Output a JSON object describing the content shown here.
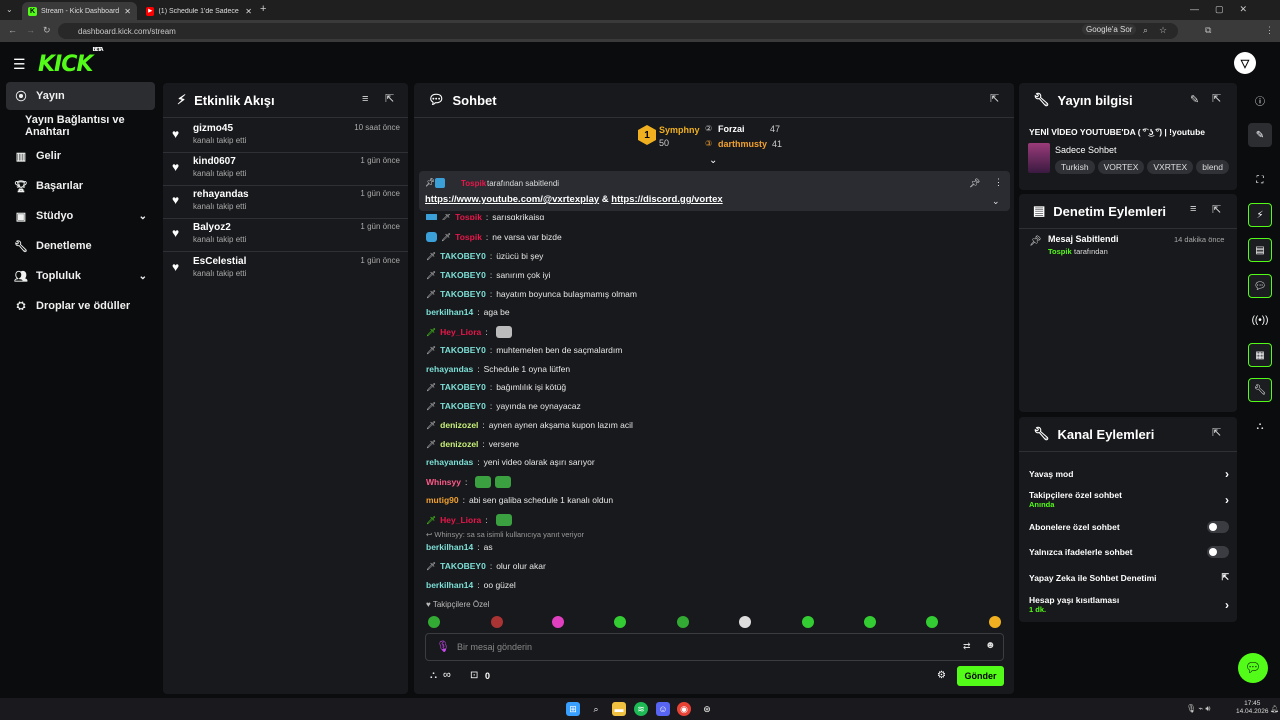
{
  "browser": {
    "tabs": [
      {
        "label": "Stream - Kick Dashboard",
        "icon": "kick-favicon-icon"
      },
      {
        "label": "(1) Schedule 1'de Sadece KUMA",
        "icon": "youtube-favicon-icon"
      }
    ],
    "url": "dashboard.kick.com/stream",
    "google_label": "Google'a Sor"
  },
  "logo": {
    "text": "KICK",
    "beta": "BETA"
  },
  "sidebar": {
    "items": [
      {
        "label": "Yayın",
        "icon": "broadcast-icon"
      },
      {
        "label": "Yayın Bağlantısı ve Anahtarı"
      },
      {
        "label": "Gelir",
        "icon": "chart-icon"
      },
      {
        "label": "Başarılar",
        "icon": "trophy-icon"
      },
      {
        "label": "Stüdyo",
        "icon": "studio-icon"
      },
      {
        "label": "Denetleme",
        "icon": "wrench-icon"
      },
      {
        "label": "Topluluk",
        "icon": "community-icon"
      },
      {
        "label": "Droplar ve ödüller",
        "icon": "drops-icon"
      }
    ]
  },
  "activity": {
    "title": "Etkinlik Akışı",
    "items": [
      {
        "name": "gizmo45",
        "action": "kanalı takip etti",
        "time": "10 saat önce"
      },
      {
        "name": "kind0607",
        "action": "kanalı takip etti",
        "time": "1 gün önce"
      },
      {
        "name": "rehayandas",
        "action": "kanalı takip etti",
        "time": "1 gün önce"
      },
      {
        "name": "Balyoz2",
        "action": "kanalı takip etti",
        "time": "1 gün önce"
      },
      {
        "name": "EsCelestial",
        "action": "kanalı takip etti",
        "time": "1 gün önce"
      }
    ]
  },
  "chat": {
    "title": "Sohbet",
    "leaderboard": [
      {
        "name": "Symphny",
        "value": "50"
      },
      {
        "name": "Forzai",
        "value": "47"
      },
      {
        "name": "darthmusty",
        "value": "41"
      }
    ],
    "pinned": {
      "by_user": "Tospik",
      "by_text": "tarafından sabitlendi",
      "link1": "https://www.youtube.com/@vxrtexplay",
      "amp": "&",
      "link2": "https://discord.gg/vortex"
    },
    "messages": [
      {
        "user": "Tospik",
        "text": "sarışgkrikaisg",
        "color": "#e8164a"
      },
      {
        "user": "Tospik",
        "text": "ne varsa var bizde",
        "color": "#e8164a"
      },
      {
        "user": "TAKOBEY0",
        "text": "üzücü bi şey",
        "color": "#7de0d8"
      },
      {
        "user": "TAKOBEY0",
        "text": "sanırım çok iyi",
        "color": "#7de0d8"
      },
      {
        "user": "TAKOBEY0",
        "text": "hayatım boyunca bulaşmamış olmam",
        "color": "#7de0d8"
      },
      {
        "user": "berkilhan14",
        "text": "aga be",
        "color": "#7de0d8"
      },
      {
        "user": "Hey_Liora",
        "text": "",
        "color": "#e8164a"
      },
      {
        "user": "TAKOBEY0",
        "text": "muhtemelen ben de saçmalardım",
        "color": "#7de0d8"
      },
      {
        "user": "rehayandas",
        "text": "Schedule 1 oyna lütfen",
        "color": "#7de0d8"
      },
      {
        "user": "TAKOBEY0",
        "text": "bağımlılık işi kötüğ",
        "color": "#7de0d8"
      },
      {
        "user": "TAKOBEY0",
        "text": "yayında ne oynayacaz",
        "color": "#7de0d8"
      },
      {
        "user": "denizozel",
        "text": "aynen aynen akşama kupon lazım acil",
        "color": "#c8f07a"
      },
      {
        "user": "denizozel",
        "text": "versene",
        "color": "#c8f07a"
      },
      {
        "user": "rehayandas",
        "text": "yeni video olarak aşırı sarıyor",
        "color": "#7de0d8"
      },
      {
        "user": "Whinsyy",
        "text": "",
        "color": "#ff5a8a"
      },
      {
        "user": "mutig90",
        "text": "abi sen galiba schedule 1 kanalı oldun",
        "color": "#f0a030"
      },
      {
        "user": "Hey_Liora",
        "text": "",
        "color": "#e8164a"
      },
      {
        "user": "berkilhan14",
        "text": "as",
        "color": "#7de0d8"
      },
      {
        "user": "TAKOBEY0",
        "text": "olur olur akar",
        "color": "#7de0d8"
      },
      {
        "user": "berkilhan14",
        "text": "oo güzel",
        "color": "#7de0d8"
      }
    ],
    "reply_note": "Whinsyy: sa sa isimli kullanıcıya yanıt veriyor",
    "followers_only": "Takipçilere Özel",
    "input_placeholder": "Bir mesaj gönderin",
    "infinity": "∞",
    "points": "0",
    "send_label": "Gönder"
  },
  "stream_info": {
    "title": "Yayın bilgisi",
    "stream_title": "YENİ VİDEO YOUTUBE'DA ( ͡° ͜ʖ ͡°) | !youtube",
    "category": "Sadece Sohbet",
    "tags": [
      "Turkish",
      "VORTEX",
      "VXRTEX",
      "blend"
    ]
  },
  "mod_actions": {
    "title": "Denetim Eylemleri",
    "item": {
      "action": "Mesaj Sabitlendi",
      "time": "14 dakika önce",
      "by_user": "Tospik",
      "by_text": "tarafından"
    }
  },
  "channel_actions": {
    "title": "Kanal Eylemleri",
    "rows": [
      {
        "label": "Yavaş mod",
        "sub": ""
      },
      {
        "label": "Takipçilere özel sohbet",
        "sub": "Anında"
      },
      {
        "label": "Abonelere özel sohbet",
        "sub": ""
      },
      {
        "label": "Yalnızca ifadelerle sohbet",
        "sub": ""
      },
      {
        "label": "Yapay Zeka ile Sohbet Denetimi",
        "sub": ""
      },
      {
        "label": "Hesap yaşı kısıtlaması",
        "sub": "1 dk."
      }
    ]
  },
  "taskbar": {
    "time": "17:45",
    "date": "14.04.2026"
  },
  "colors": {
    "accent": "#53fc18",
    "panel": "#18191c",
    "bg": "#0b0c0d"
  }
}
